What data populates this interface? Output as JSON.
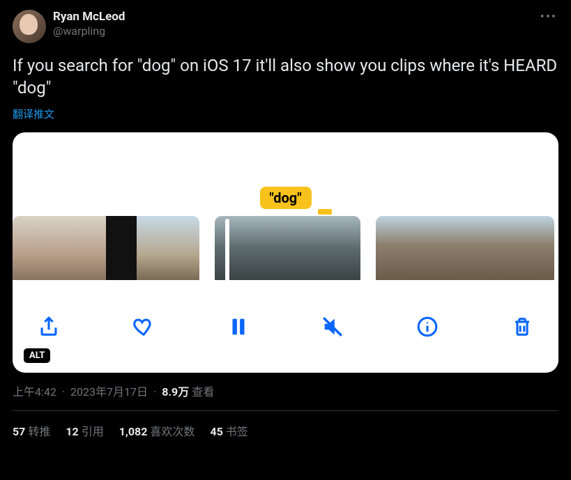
{
  "author": {
    "display_name": "Ryan McLeod",
    "handle": "@warpling"
  },
  "body_text": "If you search for \"dog\" on iOS 17 it'll also show you clips where it's HEARD \"dog\"",
  "translate_label": "翻译推文",
  "media": {
    "caption_text": "\"dog\"",
    "alt_badge": "ALT",
    "toolbar": {
      "share": "share-icon",
      "like": "heart-icon",
      "pause": "pause-icon",
      "mute": "mute-icon",
      "info": "info-icon",
      "delete": "trash-icon"
    }
  },
  "meta": {
    "time": "上午4:42",
    "date": "2023年7月17日",
    "views_number": "8.9万",
    "views_label": "查看"
  },
  "stats": {
    "retweets_count": "57",
    "retweets_label": "转推",
    "quotes_count": "12",
    "quotes_label": "引用",
    "likes_count": "1,082",
    "likes_label": "喜欢次数",
    "bookmarks_count": "45",
    "bookmarks_label": "书签"
  },
  "more_icon": "•••"
}
